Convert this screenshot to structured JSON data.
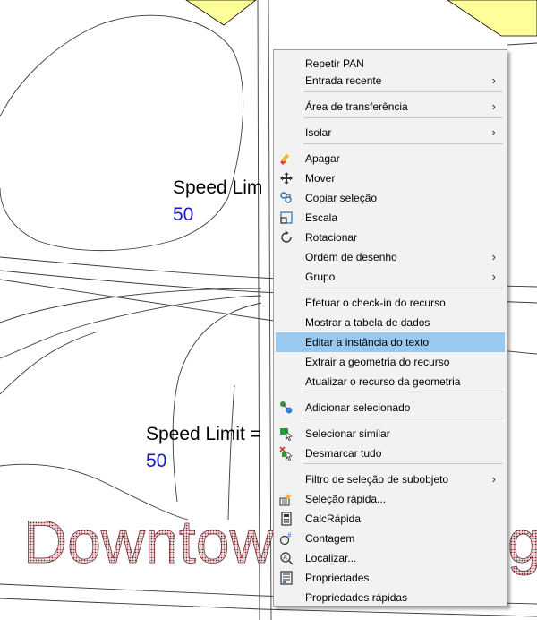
{
  "drawing": {
    "labels": [
      {
        "speed": "Speed Lim",
        "value": "50"
      },
      {
        "speed": "Speed Limit =",
        "value": "50"
      }
    ],
    "watermark": {
      "left": "Downtow",
      "right": "g"
    }
  },
  "menu": {
    "items": [
      {
        "label": "Repetir PAN",
        "icon": "",
        "submenu": false
      },
      {
        "label": "Entrada recente",
        "icon": "",
        "submenu": true
      },
      {
        "label": "Área de transferência",
        "icon": "",
        "submenu": true
      },
      {
        "label": "Isolar",
        "icon": "",
        "submenu": true
      },
      {
        "label": "Apagar",
        "icon": "eraser-icon",
        "submenu": false
      },
      {
        "label": "Mover",
        "icon": "move-icon",
        "submenu": false
      },
      {
        "label": "Copiar seleção",
        "icon": "copy-icon",
        "submenu": false
      },
      {
        "label": "Escala",
        "icon": "scale-icon",
        "submenu": false
      },
      {
        "label": "Rotacionar",
        "icon": "rotate-icon",
        "submenu": false
      },
      {
        "label": "Ordem de desenho",
        "icon": "",
        "submenu": true
      },
      {
        "label": "Grupo",
        "icon": "",
        "submenu": true
      },
      {
        "label": "Efetuar o check-in do recurso",
        "icon": "",
        "submenu": false
      },
      {
        "label": "Mostrar a tabela de dados",
        "icon": "",
        "submenu": false
      },
      {
        "label": "Editar a instância do texto",
        "icon": "",
        "submenu": false,
        "highlighted": true
      },
      {
        "label": "Extrair a geometria do recurso",
        "icon": "",
        "submenu": false
      },
      {
        "label": "Atualizar o recurso da geometria",
        "icon": "",
        "submenu": false
      },
      {
        "label": "Adicionar selecionado",
        "icon": "add-selected-icon",
        "submenu": false
      },
      {
        "label": "Selecionar similar",
        "icon": "select-similar-icon",
        "submenu": false
      },
      {
        "label": "Desmarcar tudo",
        "icon": "deselect-all-icon",
        "submenu": false
      },
      {
        "label": "Filtro de seleção de subobjeto",
        "icon": "",
        "submenu": true
      },
      {
        "label": "Seleção rápida...",
        "icon": "quick-select-icon",
        "submenu": false
      },
      {
        "label": "CalcRápida",
        "icon": "calculator-icon",
        "submenu": false
      },
      {
        "label": "Contagem",
        "icon": "count-icon",
        "submenu": false
      },
      {
        "label": "Localizar...",
        "icon": "find-icon",
        "submenu": false
      },
      {
        "label": "Propriedades",
        "icon": "properties-icon",
        "submenu": false
      },
      {
        "label": "Propriedades rápidas",
        "icon": "",
        "submenu": false
      }
    ],
    "highlight_color": "#99c9ef",
    "submenu_arrow": "›"
  }
}
